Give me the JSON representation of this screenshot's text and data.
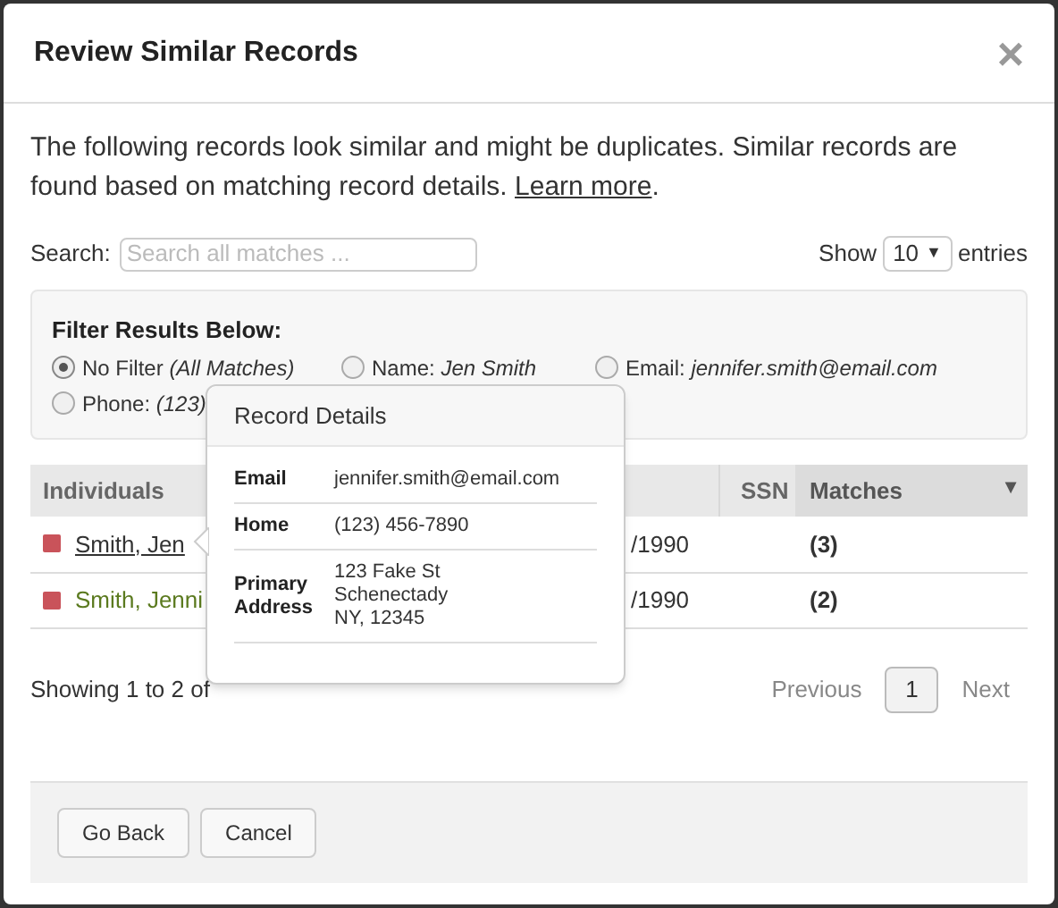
{
  "dialog": {
    "title": "Review Similar Records",
    "close": "×"
  },
  "intro": {
    "text": "The following records look similar and might be duplicates. Similar records are found based on matching record details.",
    "link": "Learn more",
    "end": "."
  },
  "search": {
    "label": "Search:",
    "placeholder": "Search all matches ..."
  },
  "page_size": {
    "label_before": "Show",
    "value": "10",
    "caret": "▼",
    "label_after": "entries"
  },
  "filter": {
    "title": "Filter Results Below:",
    "options": [
      {
        "label": "No Filter",
        "detail": "(All Matches)",
        "selected": true
      },
      {
        "label": "Name:",
        "detail": "Jen Smith",
        "selected": false
      },
      {
        "label": "Email:",
        "detail": "jennifer.smith@email.com",
        "selected": false
      },
      {
        "label": "Phone:",
        "detail": "(123)",
        "selected": false
      }
    ]
  },
  "table": {
    "columns": [
      {
        "label": "Individuals",
        "sorted": false
      },
      {
        "label": "SSN",
        "sorted": false
      },
      {
        "label": "Matches",
        "sorted": true,
        "caret": "▼"
      }
    ],
    "rows": [
      {
        "name": "Smith, Jen",
        "date": "/1990",
        "matches": "(3)",
        "color": "#c9535a",
        "hovered": true
      },
      {
        "name": "Smith, Jenni",
        "date": "/1990",
        "matches": "(2)",
        "color": "#c9535a",
        "hovered": false
      }
    ]
  },
  "info": "Showing 1 to 2 of",
  "pagination": {
    "previous": "Previous",
    "pages": [
      {
        "label": "1",
        "selected": true
      }
    ],
    "next": "Next"
  },
  "popover": {
    "title": "Record Details",
    "fields": [
      {
        "label": "Email",
        "lines": [
          "jennifer.smith@email.com"
        ]
      },
      {
        "label": "Home",
        "lines": [
          "(123) 456-7890"
        ]
      },
      {
        "label": "Primary Address",
        "lines": [
          "123 Fake St",
          "Schenectady",
          "NY, 12345"
        ]
      }
    ]
  },
  "buttons": [
    "Go Back",
    "Cancel"
  ]
}
